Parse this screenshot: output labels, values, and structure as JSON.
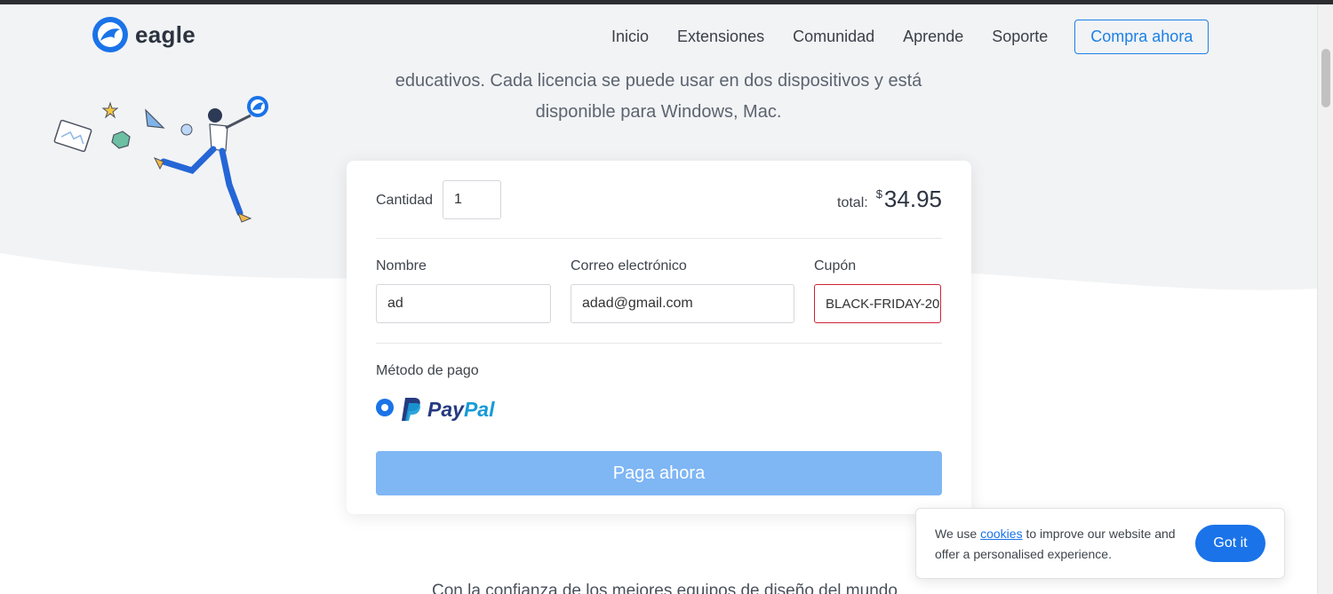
{
  "brand": {
    "name": "eagle"
  },
  "nav": {
    "links": [
      "Inicio",
      "Extensiones",
      "Comunidad",
      "Aprende",
      "Soporte"
    ],
    "cta": "Compra ahora"
  },
  "intro": {
    "line1": "educativos. Cada licencia se puede usar en dos dispositivos y está",
    "line2": "disponible para Windows, Mac."
  },
  "checkout": {
    "quantity_label": "Cantidad",
    "quantity_value": "1",
    "total_label": "total:",
    "currency": "$",
    "total_amount": "34.95",
    "name_label": "Nombre",
    "name_value": "ad",
    "email_label": "Correo electrónico",
    "email_value": "adad@gmail.com",
    "coupon_label": "Cupón",
    "coupon_value": "BLACK-FRIDAY-20",
    "payment_label": "Método de pago",
    "payment_option": {
      "pay": "Pay",
      "pal": "Pal"
    },
    "pay_button": "Paga ahora",
    "colors": {
      "accent": "#1a73e8",
      "button_disabled": "#7fb6f4",
      "error_border": "#d0233a"
    }
  },
  "footer_teaser": "Con la confianza de los mejores equipos de diseño del mundo",
  "cookie_banner": {
    "text_before": "We use ",
    "link": "cookies",
    "text_after": " to improve our website and offer a personalised experience.",
    "button": "Got it"
  }
}
